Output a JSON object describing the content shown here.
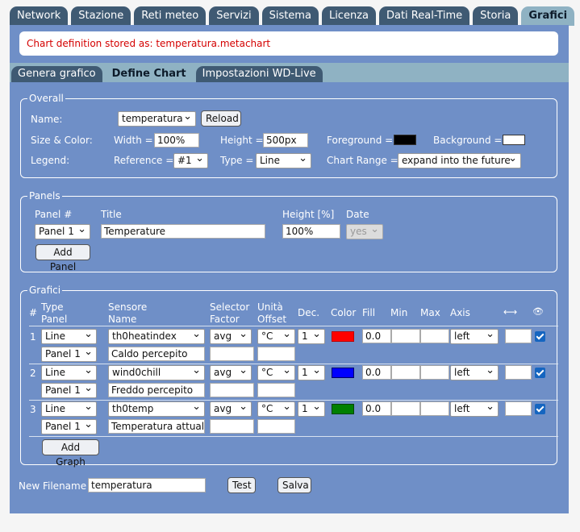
{
  "tabs": [
    "Network",
    "Stazione",
    "Reti meteo",
    "Servizi",
    "Sistema",
    "Licenza",
    "Dati Real-Time",
    "Storia",
    "Grafici"
  ],
  "notice": "Chart definition stored as: temperatura.metachart",
  "subtabs": [
    "Genera grafico",
    "Define Chart",
    "Impostazioni WD-Live"
  ],
  "overall": {
    "legend": "Overall",
    "name_label": "Name:",
    "name_value": "temperatura",
    "reload": "Reload",
    "size_label": "Size & Color:",
    "width_label": "Width =",
    "width_value": "100%",
    "height_label": "Height =",
    "height_value": "500px",
    "fg_label": "Foreground =",
    "fg_color": "#000000",
    "bg_label": "Background =",
    "bg_color": "#ffffff",
    "legend_label": "Legend:",
    "reference_label": "Reference =",
    "reference_value": "#1",
    "type_label": "Type =",
    "type_value": "Line",
    "range_label": "Chart Range =",
    "range_value": "expand into the future"
  },
  "panels": {
    "legend": "Panels",
    "h_panel": "Panel #",
    "h_title": "Title",
    "h_height": "Height [%]",
    "h_date": "Date",
    "panel_value": "Panel 1",
    "title_value": "Temperature",
    "height_value": "100%",
    "date_value": "yes",
    "add": "Add Panel"
  },
  "grafici": {
    "legend": "Grafici",
    "h_num": "#",
    "h_type": "Type",
    "h_panel": "Panel",
    "h_sensor": "Sensore",
    "h_name": "Name",
    "h_selector": "Selector",
    "h_factor": "Factor",
    "h_unit": "Unità",
    "h_offset": "Offset",
    "h_dec": "Dec.",
    "h_color": "Color",
    "h_fill": "Fill",
    "h_min": "Min",
    "h_max": "Max",
    "h_axis": "Axis",
    "h_arrow": "⟷",
    "h_eye": "👁",
    "rows": [
      {
        "num": "1",
        "type": "Line",
        "panel": "Panel 1",
        "sensor": "th0heatindex",
        "name": "Caldo percepito",
        "selector": "avg",
        "unit": "°C",
        "dec": "1",
        "color": "#ff0000",
        "fill": "0.0",
        "axis": "left"
      },
      {
        "num": "2",
        "type": "Line",
        "panel": "Panel 1",
        "sensor": "wind0chill",
        "name": "Freddo percepito",
        "selector": "avg",
        "unit": "°C",
        "dec": "1",
        "color": "#0000ff",
        "fill": "0.0",
        "axis": "left"
      },
      {
        "num": "3",
        "type": "Line",
        "panel": "Panel 1",
        "sensor": "th0temp",
        "name": "Temperatura attual",
        "selector": "avg",
        "unit": "°C",
        "dec": "1",
        "color": "#008000",
        "fill": "0.0",
        "axis": "left"
      }
    ],
    "add": "Add Graph"
  },
  "footer": {
    "filename_label": "New Filename",
    "filename_value": "temperatura",
    "test": "Test",
    "save": "Salva"
  }
}
